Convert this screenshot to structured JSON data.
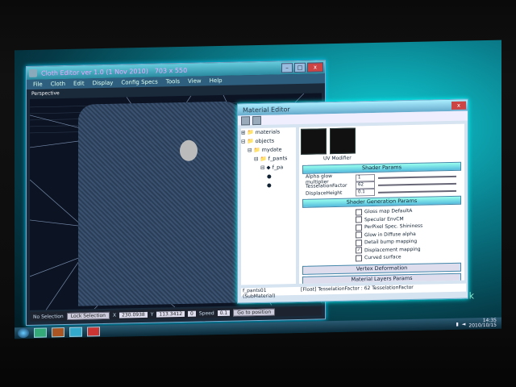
{
  "desktop": {
    "back_label": "Back"
  },
  "cloth_editor": {
    "title": "Cloth Editor ver 1.0 (1 Nov 2010)",
    "size_label": "703 x 550",
    "menu": [
      "File",
      "Cloth",
      "Edit",
      "Display",
      "Config Specs",
      "Tools",
      "View",
      "Help"
    ],
    "viewport_label": "Perspective",
    "status": {
      "selection": "No Selection",
      "lock_label": "Lock Selection",
      "x_label": "X",
      "x_value": "230.0938",
      "y_label": "Y",
      "y_value": "113.3412",
      "z_value": "0",
      "speed_label": "Speed",
      "speed_value": "0.1",
      "goto_label": "Go to position"
    }
  },
  "material_editor": {
    "title": "Material Editor",
    "tree": [
      "materials",
      "objects",
      "mydate",
      "f_pants",
      "f_pa",
      "",
      ""
    ],
    "modifier_label": "UV Modifier",
    "shader_params_title": "Shader Params",
    "params": [
      {
        "label": "Alpha glow multiplier",
        "value": "1"
      },
      {
        "label": "TesselationFactor",
        "value": "62"
      },
      {
        "label": "DisplaceHeight",
        "value": "0.1"
      }
    ],
    "generation_title": "Shader Generation Params",
    "options": [
      {
        "label": "Gloss map DefaultA",
        "checked": false
      },
      {
        "label": "Specular EnvCM",
        "checked": false
      },
      {
        "label": "PerPixel Spec. Shininess",
        "checked": false
      },
      {
        "label": "Glow in Diffuse alpha",
        "checked": false
      },
      {
        "label": "Detail bump mapping",
        "checked": false
      },
      {
        "label": "Displacement mapping",
        "checked": true
      },
      {
        "label": "Curved surface",
        "checked": false
      }
    ],
    "vertex_section": "Vertex Deformation",
    "layers_section": "Material Layers Params",
    "bottom_item": "f_pants01 (SubMaterial)",
    "status": "[Float] TesselationFactor : 62 TesselationFactor"
  },
  "taskbar": {
    "time": "14:35",
    "date": "2010/10/15"
  }
}
